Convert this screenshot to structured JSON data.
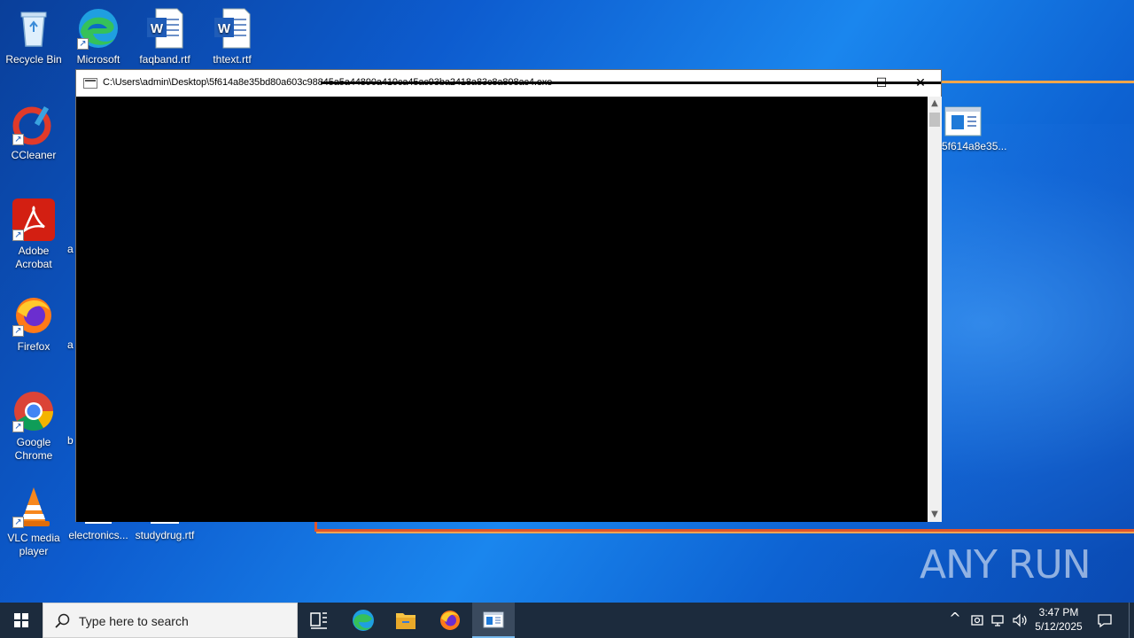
{
  "desktop": {
    "icons": [
      {
        "label": "Recycle Bin"
      },
      {
        "label": "Microsoft Edge"
      },
      {
        "label": "faqband.rtf"
      },
      {
        "label": "thtext.rtf"
      },
      {
        "label": "CCleaner"
      },
      {
        "label": "Adobe Acrobat"
      },
      {
        "label": "Firefox"
      },
      {
        "label": "Google Chrome"
      },
      {
        "label": "VLC media player"
      },
      {
        "label": "electronics..."
      },
      {
        "label": "studydrug.rtf"
      },
      {
        "label": "5f614a8e35..."
      }
    ],
    "partial_labels": [
      "a",
      "a",
      "b"
    ]
  },
  "console_window": {
    "title": "C:\\Users\\admin\\Desktop\\5f614a8e35bd80a603c98845a5a44890a410ca45ac93ba2418a83c8a898ac4.exe",
    "minimize": "—",
    "maximize": "☐",
    "close": "✕",
    "scroll_up": "▲",
    "scroll_down": "▼"
  },
  "taskbar": {
    "search_placeholder": "Type here to search",
    "time": "3:47 PM",
    "date": "5/12/2025",
    "tray": {
      "chevron": "^",
      "notifications": "▢"
    }
  },
  "watermark": "ANY RUN",
  "colors": {
    "taskbar_bg": "#1c2b3d",
    "accent_line": "#f3a64a",
    "red_line": "#e2552a"
  }
}
